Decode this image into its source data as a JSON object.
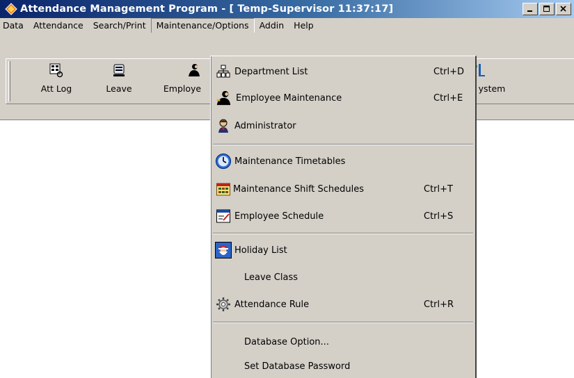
{
  "window": {
    "title": "Attendance Management Program - [ Temp-Supervisor 11:37:17]",
    "controls": {
      "minimize": "minimize",
      "maximize": "maximize",
      "close": "close"
    }
  },
  "menubar": {
    "items": [
      {
        "label": "Data"
      },
      {
        "label": "Attendance"
      },
      {
        "label": "Search/Print"
      },
      {
        "label": "Maintenance/Options"
      },
      {
        "label": "Addin"
      },
      {
        "label": "Help"
      }
    ],
    "open_menu": "Maintenance/Options"
  },
  "toolbar": {
    "buttons": [
      {
        "label": "Att Log",
        "icon": "att-log-icon"
      },
      {
        "label": "Leave",
        "icon": "leave-icon"
      },
      {
        "label": "Employe",
        "icon": "employee-icon"
      },
      {
        "label": "ystem",
        "icon": "system-icon"
      }
    ]
  },
  "dropdown": {
    "items": [
      {
        "label": "Department List",
        "shortcut": "Ctrl+D",
        "icon": "department-tree-icon"
      },
      {
        "label": "Employee Maintenance",
        "shortcut": "Ctrl+E",
        "icon": "employee-maintenance-icon"
      },
      {
        "label": "Administrator",
        "shortcut": "",
        "icon": "administrator-icon"
      },
      {
        "label": "Maintenance Timetables",
        "shortcut": "",
        "icon": "clock-icon"
      },
      {
        "label": "Maintenance Shift Schedules",
        "shortcut": "Ctrl+T",
        "icon": "calendar-icon"
      },
      {
        "label": "Employee Schedule",
        "shortcut": "Ctrl+S",
        "icon": "schedule-icon"
      },
      {
        "label": "Holiday List",
        "shortcut": "",
        "icon": "santa-icon"
      },
      {
        "label": "Leave Class",
        "shortcut": "",
        "icon": ""
      },
      {
        "label": "Attendance Rule",
        "shortcut": "Ctrl+R",
        "icon": "gears-icon"
      },
      {
        "label": "Database Option...",
        "shortcut": "",
        "icon": ""
      },
      {
        "label": "Set Database Password",
        "shortcut": "",
        "icon": ""
      }
    ]
  },
  "colors": {
    "title_gradient_start": "#0a246a",
    "title_gradient_end": "#a6caf0",
    "face": "#d4d0c8",
    "background": "#ffffff"
  }
}
